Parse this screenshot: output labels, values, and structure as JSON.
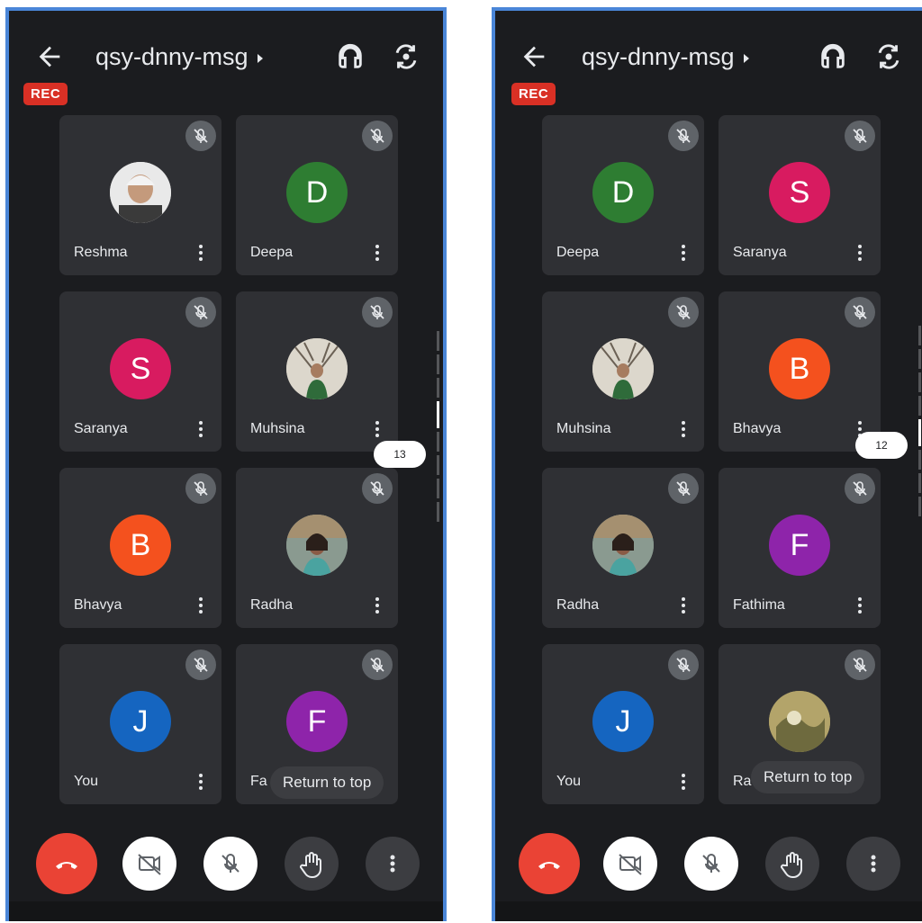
{
  "phones": [
    {
      "meeting_code": "qsy-dnny-msg",
      "rec_label": "REC",
      "page_indicator": "13",
      "return_to_top": "Return to top",
      "participants": [
        {
          "name": "Reshma",
          "initial": "",
          "color": "#cfcfcf",
          "photo": true
        },
        {
          "name": "Deepa",
          "initial": "D",
          "color": "#2e7d32",
          "photo": false
        },
        {
          "name": "Saranya",
          "initial": "S",
          "color": "#d81b60",
          "photo": false
        },
        {
          "name": "Muhsina",
          "initial": "",
          "color": "#b0a89a",
          "photo": true
        },
        {
          "name": "Bhavya",
          "initial": "B",
          "color": "#f4511e",
          "photo": false
        },
        {
          "name": "Radha",
          "initial": "",
          "color": "#7c8a80",
          "photo": true
        },
        {
          "name": "You",
          "initial": "J",
          "color": "#1565c0",
          "photo": false
        },
        {
          "name": "Fa",
          "initial": "F",
          "color": "#8e24aa",
          "photo": false
        }
      ]
    },
    {
      "meeting_code": "qsy-dnny-msg",
      "rec_label": "REC",
      "page_indicator": "12",
      "return_to_top": "Return to top",
      "participants": [
        {
          "name": "Deepa",
          "initial": "D",
          "color": "#2e7d32",
          "photo": false
        },
        {
          "name": "Saranya",
          "initial": "S",
          "color": "#d81b60",
          "photo": false
        },
        {
          "name": "Muhsina",
          "initial": "",
          "color": "#b0a89a",
          "photo": true
        },
        {
          "name": "Bhavya",
          "initial": "B",
          "color": "#f4511e",
          "photo": false
        },
        {
          "name": "Radha",
          "initial": "",
          "color": "#7c8a80",
          "photo": true
        },
        {
          "name": "Fathima",
          "initial": "F",
          "color": "#8e24aa",
          "photo": false
        },
        {
          "name": "You",
          "initial": "J",
          "color": "#1565c0",
          "photo": false
        },
        {
          "name": "Ra",
          "initial": "",
          "color": "#a0915a",
          "photo": true
        }
      ]
    }
  ],
  "icons": {
    "back": "arrow-back-icon",
    "audio": "headset-icon",
    "camera_switch": "flip-camera-icon",
    "mic_off": "mic-off-icon",
    "more": "more-vert-icon",
    "end_call": "call-end-icon",
    "camera_off": "camera-off-icon",
    "raise_hand": "hand-icon"
  },
  "colors": {
    "background": "#1b1c1f",
    "tile": "#2f3034",
    "rec": "#d93025",
    "end_call": "#ea4335",
    "frame": "#4a86d8"
  }
}
